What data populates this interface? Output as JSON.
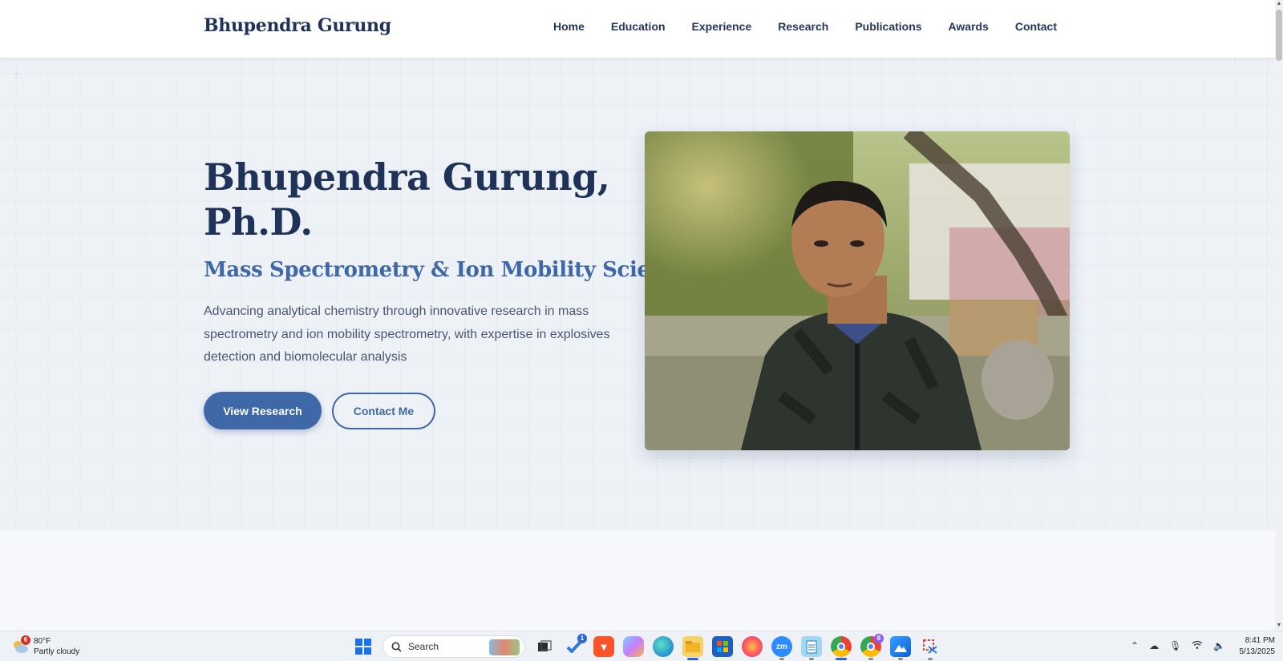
{
  "header": {
    "brand": "Bhupendra Gurung",
    "nav": [
      "Home",
      "Education",
      "Experience",
      "Research",
      "Publications",
      "Awards",
      "Contact"
    ]
  },
  "hero": {
    "title_line1": "Bhupendra Gurung,",
    "title_line2": "Ph.D.",
    "subtitle": "Mass Spectrometry & Ion Mobility Scientist",
    "description": "Advancing analytical chemistry through innovative research in mass spectrometry and ion mobility spectrometry, with expertise in explosives detection and biomolecular analysis",
    "primary_button": "View Research",
    "secondary_button": "Contact Me",
    "photo_icon": "portrait-photo"
  },
  "colors": {
    "brand_navy": "#1f3257",
    "accent_blue": "#3f68a8",
    "background": "#eef2f7"
  },
  "taskbar": {
    "weather": {
      "badge": "6",
      "temp": "80°F",
      "condition": "Partly cloudy"
    },
    "search_label": "Search",
    "pinned_badges": {
      "todo": "1",
      "chrome_profile": "8"
    },
    "time": "8:41 PM",
    "date": "5/13/2025"
  }
}
